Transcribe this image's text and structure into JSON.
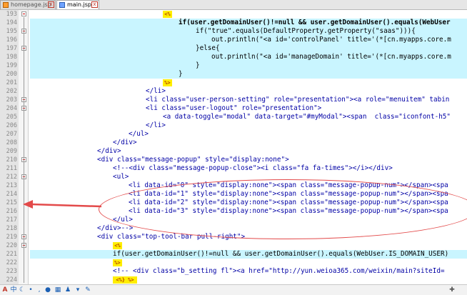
{
  "tabs": [
    {
      "label": "homepage.jsp",
      "active": false
    },
    {
      "label": "main.jsp",
      "active": true
    }
  ],
  "tab_close_glyph": "x",
  "editor_lines": [
    {
      "num": "193",
      "text": "<%",
      "kind": "jsp"
    },
    {
      "num": "194",
      "text": "if(user.getDomainUser()!=null && user.getDomainUser().equals(WebUser",
      "kind": "jspline bold",
      "indent": 208,
      "hl": true
    },
    {
      "num": "195",
      "text": "if(\"true\".equals(DefaultProperty.getProperty(\"saas\"))){",
      "kind": "jspline",
      "indent": 232,
      "hl": true
    },
    {
      "num": "196",
      "text": "out.println(\"<a id='controlPanel' title='(*[cn.myapps.core.m",
      "kind": "jspline",
      "indent": 254,
      "hl": true
    },
    {
      "num": "197",
      "text": "}else{",
      "kind": "jspline",
      "indent": 232,
      "hl": true
    },
    {
      "num": "198",
      "text": "out.println(\"<a id='manageDomain' title='(*[cn.myapps.core.m",
      "kind": "jspline",
      "indent": 254,
      "hl": true
    },
    {
      "num": "199",
      "text": "}",
      "kind": "jspline",
      "indent": 232,
      "hl": true
    },
    {
      "num": "200",
      "text": "}",
      "kind": "jspline",
      "indent": 208,
      "hl": true
    },
    {
      "num": "201",
      "text": "%>",
      "kind": "jsp"
    },
    {
      "num": "202",
      "text": "</li>",
      "kind": "tagline",
      "indent": 162
    },
    {
      "num": "203",
      "text": "<li class=\"user-person-setting\" role=\"presentation\"><a role=\"menuitem\" tabin",
      "kind": "tagline",
      "indent": 162
    },
    {
      "num": "204",
      "text": "<li class=\"user-logout\" role=\"presentation\">",
      "kind": "tagline",
      "indent": 162
    },
    {
      "num": "205",
      "text": "<a data-toggle=\"modal\" data-target=\"#myModal\"><span  class=\"iconfont-h5\"",
      "kind": "tagline",
      "indent": 186
    },
    {
      "num": "206",
      "text": "</li>",
      "kind": "tagline",
      "indent": 162
    },
    {
      "num": "207",
      "text": "</ul>",
      "kind": "tagline",
      "indent": 138
    },
    {
      "num": "208",
      "text": "</div>",
      "kind": "tagline",
      "indent": 116
    },
    {
      "num": "209",
      "text": "</div>",
      "kind": "tagline",
      "indent": 94
    },
    {
      "num": "210",
      "text": "<div class=\"message-popup\" style=\"display:none\">",
      "kind": "tagline",
      "indent": 94
    },
    {
      "num": "211",
      "text": "<!--<div class=\"message-popup-close\"><i class=\"fa fa-times\"></i></div>",
      "kind": "tagline",
      "indent": 116
    },
    {
      "num": "212",
      "text": "<ul>",
      "kind": "tagline",
      "indent": 116
    },
    {
      "num": "213",
      "text": "<li data-id=\"0\" style=\"display:none\"><span class=\"message-popup-num\"></span><spa",
      "kind": "tagline",
      "indent": 138
    },
    {
      "num": "214",
      "text": "<li data-id=\"1\" style=\"display:none\"><span class=\"message-popup-num\"></span><spa",
      "kind": "tagline",
      "indent": 138
    },
    {
      "num": "215",
      "text": "<li data-id=\"2\" style=\"display:none\"><span class=\"message-popup-num\"></span><spa",
      "kind": "tagline",
      "indent": 138
    },
    {
      "num": "216",
      "text": "<li data-id=\"3\" style=\"display:none\"><span class=\"message-popup-num\"></span><spa",
      "kind": "tagline",
      "indent": 138
    },
    {
      "num": "217",
      "text": "</ul>",
      "kind": "tagline",
      "indent": 116
    },
    {
      "num": "218",
      "text": "</div>-->",
      "kind": "tagline",
      "indent": 94
    },
    {
      "num": "219",
      "text": "<div class=\"top-tool-bar pull-right\">",
      "kind": "tagline",
      "indent": 94
    },
    {
      "num": "220",
      "text": "<%",
      "kind": "jsp"
    },
    {
      "num": "221",
      "text": "if(user.getDomainUser()!=null && user.getDomainUser().equals(WebUser.IS_DOMAIN_USER)",
      "kind": "jspline",
      "indent": 116,
      "hl": true
    },
    {
      "num": "222",
      "text": "%>",
      "kind": "jsp"
    },
    {
      "num": "223",
      "text": "<!-- <div class=\"b_setting fl\"><a href=\"http://yun.weioa365.com/weixin/main?siteId=",
      "kind": "tagline",
      "indent": 116
    },
    {
      "num": "224",
      "text": "<%} %>",
      "kind": "jsp"
    }
  ],
  "taskbar_icons": [
    "app-icon",
    "ime-zh-icon",
    "moon-icon",
    "punctuation-icon",
    "mic-icon",
    "keyboard-icon",
    "person-icon",
    "shirt-icon",
    "wrench-icon"
  ],
  "taskbar_ime_label": "中",
  "colors": {
    "highlight": "#c9f5ff",
    "annotation": "#e34a4a",
    "tag_blue": "#0000a5",
    "jsp_marker": "#ffee00"
  }
}
